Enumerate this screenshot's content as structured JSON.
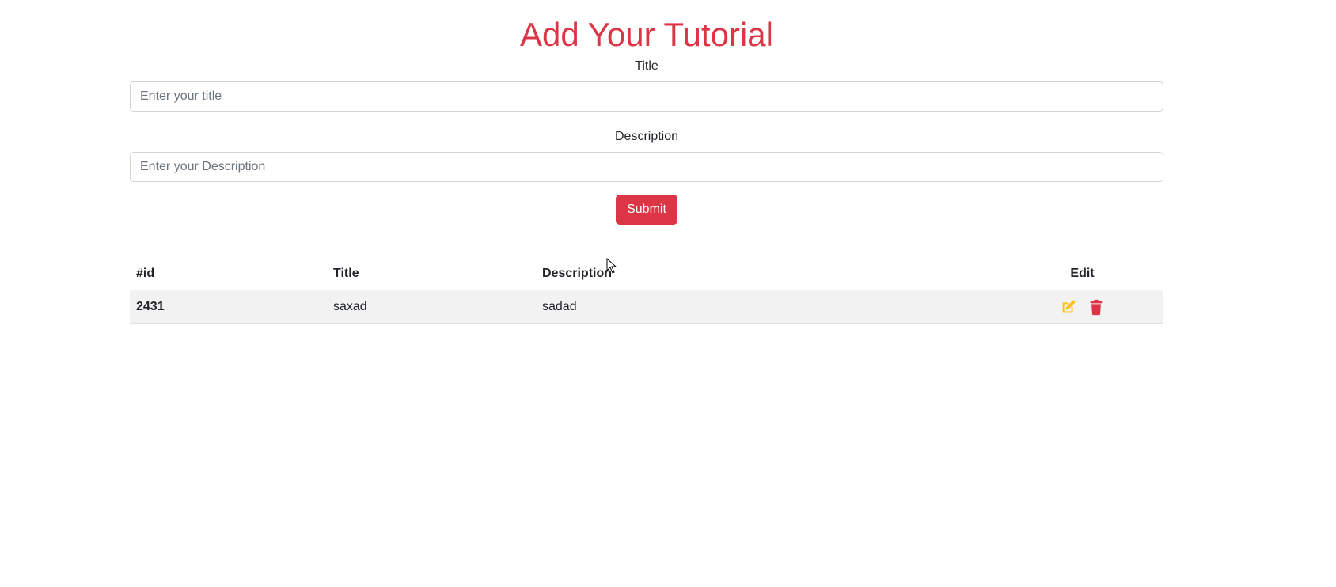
{
  "header": {
    "title": "Add Your Tutorial"
  },
  "form": {
    "title_label": "Title",
    "title_placeholder": "Enter your title",
    "title_value": "",
    "description_label": "Description",
    "description_placeholder": "Enter your Description",
    "description_value": "",
    "submit_label": "Submit"
  },
  "table": {
    "columns": [
      "#id",
      "Title",
      "Description",
      "Edit"
    ],
    "rows": [
      {
        "id": "2431",
        "title": "saxad",
        "description": "sadad"
      }
    ]
  },
  "icons": {
    "edit": "edit-icon",
    "delete": "trash-icon"
  },
  "colors": {
    "accent": "#dc3545",
    "edit_icon": "#ffc107",
    "delete_icon": "#dc3545",
    "row_bg": "#f2f2f2"
  }
}
